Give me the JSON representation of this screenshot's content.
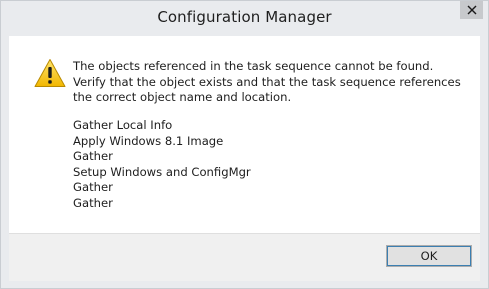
{
  "window": {
    "title": "Configuration Manager",
    "close_icon": "close-icon"
  },
  "dialog": {
    "icon": "warning-icon",
    "message": "The objects referenced in the task sequence cannot be found. Verify that the object exists and that the task sequence references the correct object name and location.",
    "steps": [
      "Gather Local Info",
      "Apply Windows 8.1 Image",
      "Gather",
      "Setup Windows and ConfigMgr",
      "Gather",
      "Gather"
    ]
  },
  "buttons": {
    "ok_label": "OK"
  },
  "colors": {
    "close_button": "#c7c9cc",
    "warning_fill": "#f5c518",
    "chrome": "#e9ebee"
  }
}
